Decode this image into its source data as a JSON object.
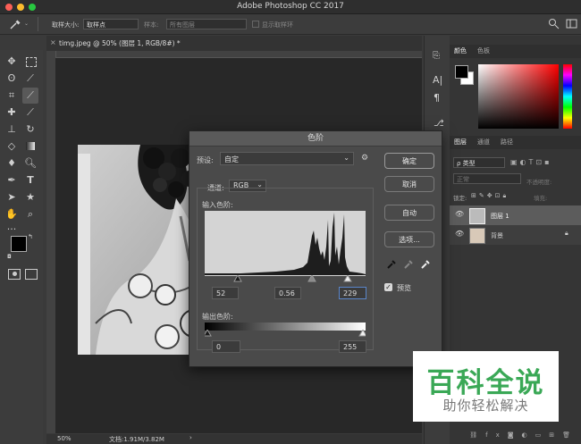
{
  "app": {
    "title": "Adobe Photoshop CC 2017"
  },
  "options_bar": {
    "sample_size_label": "取样大小:",
    "sample_size_value": "取样点",
    "sample_label": "样本:",
    "sample_value": "所有图层",
    "show_ring_label": "显示取样环"
  },
  "document": {
    "tab_label": "timg.jpeg @ 50% (图层 1, RGB/8#) *",
    "zoom": "50%",
    "doc_info": "文档:1.91M/3.82M"
  },
  "panels": {
    "color_tabs": [
      "颜色",
      "色板"
    ],
    "layers_tabs": [
      "图层",
      "通道",
      "路径"
    ],
    "kind_filter": "ρ 类型",
    "blend_mode": "正常",
    "opacity_label": "不透明度:",
    "lock_label": "锁定:",
    "fill_label": "填充:",
    "layers": [
      {
        "name": "图层 1"
      },
      {
        "name": "背景"
      }
    ]
  },
  "levels_dialog": {
    "title": "色阶",
    "preset_label": "预设:",
    "preset_value": "自定",
    "channel_label": "通道:",
    "channel_value": "RGB",
    "input_label": "输入色阶:",
    "input_black": "52",
    "input_gamma": "0.56",
    "input_white": "229",
    "output_label": "输出色阶:",
    "output_black": "0",
    "output_white": "255",
    "buttons": {
      "ok": "确定",
      "cancel": "取消",
      "auto": "自动",
      "options": "选项..."
    },
    "preview_label": "预览",
    "preview_checked": true
  },
  "watermark": {
    "title": "百科全说",
    "subtitle": "助你轻松解决"
  },
  "colors": {
    "accent_green": "#3aa856",
    "focus_blue": "#4a7fd0"
  }
}
